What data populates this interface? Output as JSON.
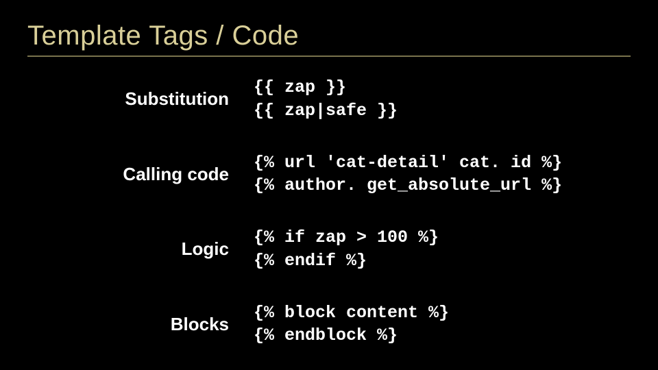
{
  "title": "Template Tags / Code",
  "rows": [
    {
      "label": "Substitution",
      "code": "{{ zap }}\n{{ zap|safe }}"
    },
    {
      "label": "Calling code",
      "code": "{% url 'cat-detail' cat. id %}\n{% author. get_absolute_url %}"
    },
    {
      "label": "Logic",
      "code": "{% if zap > 100 %}\n{% endif %}"
    },
    {
      "label": "Blocks",
      "code": "{% block content %}\n{% endblock %}"
    }
  ]
}
